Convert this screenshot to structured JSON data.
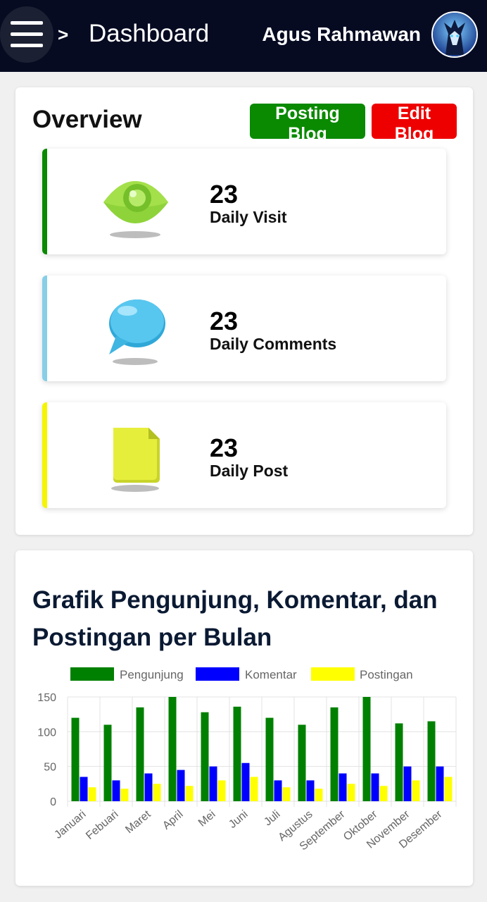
{
  "header": {
    "separator": ">",
    "title": "Dashboard",
    "user_name": "Agus Rahmawan"
  },
  "overview": {
    "title": "Overview",
    "post_button": "Posting Blog",
    "edit_button": "Edit Blog",
    "stats": [
      {
        "value": "23",
        "label": "Daily Visit",
        "color": "#0a8a00",
        "icon": "eye-icon"
      },
      {
        "value": "23",
        "label": "Daily Comments",
        "color": "#87cee8",
        "icon": "chat-bubble-icon"
      },
      {
        "value": "23",
        "label": "Daily Post",
        "color": "#f5f500",
        "icon": "document-icon"
      }
    ]
  },
  "chart_section": {
    "title": "Grafik Pengunjung, Komentar, dan Postingan per Bulan"
  },
  "chart_data": {
    "type": "bar",
    "categories": [
      "Januari",
      "Febuari",
      "Maret",
      "April",
      "Mei",
      "Juni",
      "Juli",
      "Agustus",
      "September",
      "Oktober",
      "November",
      "Desember"
    ],
    "series": [
      {
        "name": "Pengunjung",
        "color": "#008000",
        "values": [
          120,
          110,
          135,
          150,
          128,
          136,
          120,
          110,
          135,
          150,
          112,
          115
        ]
      },
      {
        "name": "Komentar",
        "color": "#0000ff",
        "values": [
          35,
          30,
          40,
          45,
          50,
          55,
          30,
          30,
          40,
          40,
          50,
          50
        ]
      },
      {
        "name": "Postingan",
        "color": "#ffff00",
        "values": [
          20,
          18,
          25,
          22,
          30,
          35,
          20,
          18,
          25,
          22,
          30,
          35
        ]
      }
    ],
    "ylim": [
      0,
      150
    ],
    "yticks": [
      0,
      50,
      100,
      150
    ],
    "grid": true,
    "legend": "top"
  }
}
